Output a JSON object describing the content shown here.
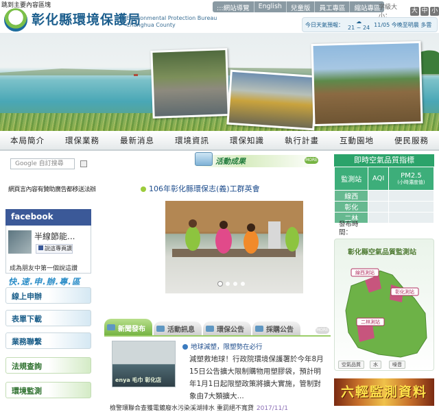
{
  "header": {
    "skip_link": "跳到主要內容區塊",
    "top_links": [
      ":::網站導覽",
      "English",
      "兒童版",
      "員工專區",
      "縮站專區"
    ],
    "font_size_label": "字級大小：",
    "font_sizes": [
      "大",
      "中",
      "小"
    ],
    "title_cn": "彰化縣環境保護局",
    "title_en_line1": "Environmental Protection Bureau",
    "title_en_line2": "Changhua County",
    "weather": {
      "label": "今日天氣預報：",
      "temp_range": "21 ~ 24",
      "description": "11/05 今晚至明晨 多雲"
    }
  },
  "nav": [
    "本局簡介",
    "環保業務",
    "最新消息",
    "環境資訊",
    "環保知識",
    "執行計畫",
    "互動園地",
    "便民服務"
  ],
  "sidebar": {
    "search_placeholder": "Google 自訂搜尋",
    "ad_text": "網頁言內容有贊助廣告都移送法辦",
    "facebook": {
      "header": "facebook",
      "page_name": "半線節能...",
      "like_label": "說這專頁讚",
      "message": "成為朋友中第一個說這讚"
    },
    "slogan": "快.速.申.辦.專.區",
    "buttons": [
      "線上申辦",
      "表單下載",
      "業務聯繫"
    ],
    "green_buttons": [
      "法規查詢",
      "環境監測"
    ]
  },
  "activity": {
    "title": "活動成果",
    "more": "MORE",
    "caption": "106年彰化縣環保志(義)工群英會"
  },
  "news": {
    "tabs": [
      "新聞發布",
      "活動訊息",
      "環保公告",
      "採購公告"
    ],
    "more": "MORE",
    "photo_caption": "enya 毛巾 彰化店",
    "headline": "地球減塑，限塑勢在必行",
    "body": "減塑救地球！行政院環境保護署於今年8月15日公告擴大限制購物用塑膠袋，預計明年1月1日起限塑政策將擴大實施，管制對象由7大類擴大...",
    "bottom_item": "檢警環聯合查獲電鍍廢水污染溪湖排水 重罰絕不寬貸",
    "bottom_date": "2017/11/1"
  },
  "air_quality": {
    "title": "即時空氣品質指標",
    "col_site": "監測站",
    "col_aqi": "AQI",
    "col_pm": "PM2.5",
    "col_pm_sub": "(小時濃度值)",
    "sites": [
      "線西",
      "彰化",
      "二林"
    ],
    "release_label": "發布時間："
  },
  "map": {
    "title": "彰化縣空氣品質監測站",
    "labels": [
      "線西測站",
      "彰化測站",
      "二林測站"
    ],
    "buttons": [
      "空氣品質",
      "水",
      "噪音"
    ]
  },
  "monitor_banner": "六輕監測資料",
  "colors": {
    "brand_blue": "#1d5f8e",
    "accent_green": "#76b443",
    "facebook_blue": "#3b5998",
    "aq_green": "#2ba36a"
  }
}
